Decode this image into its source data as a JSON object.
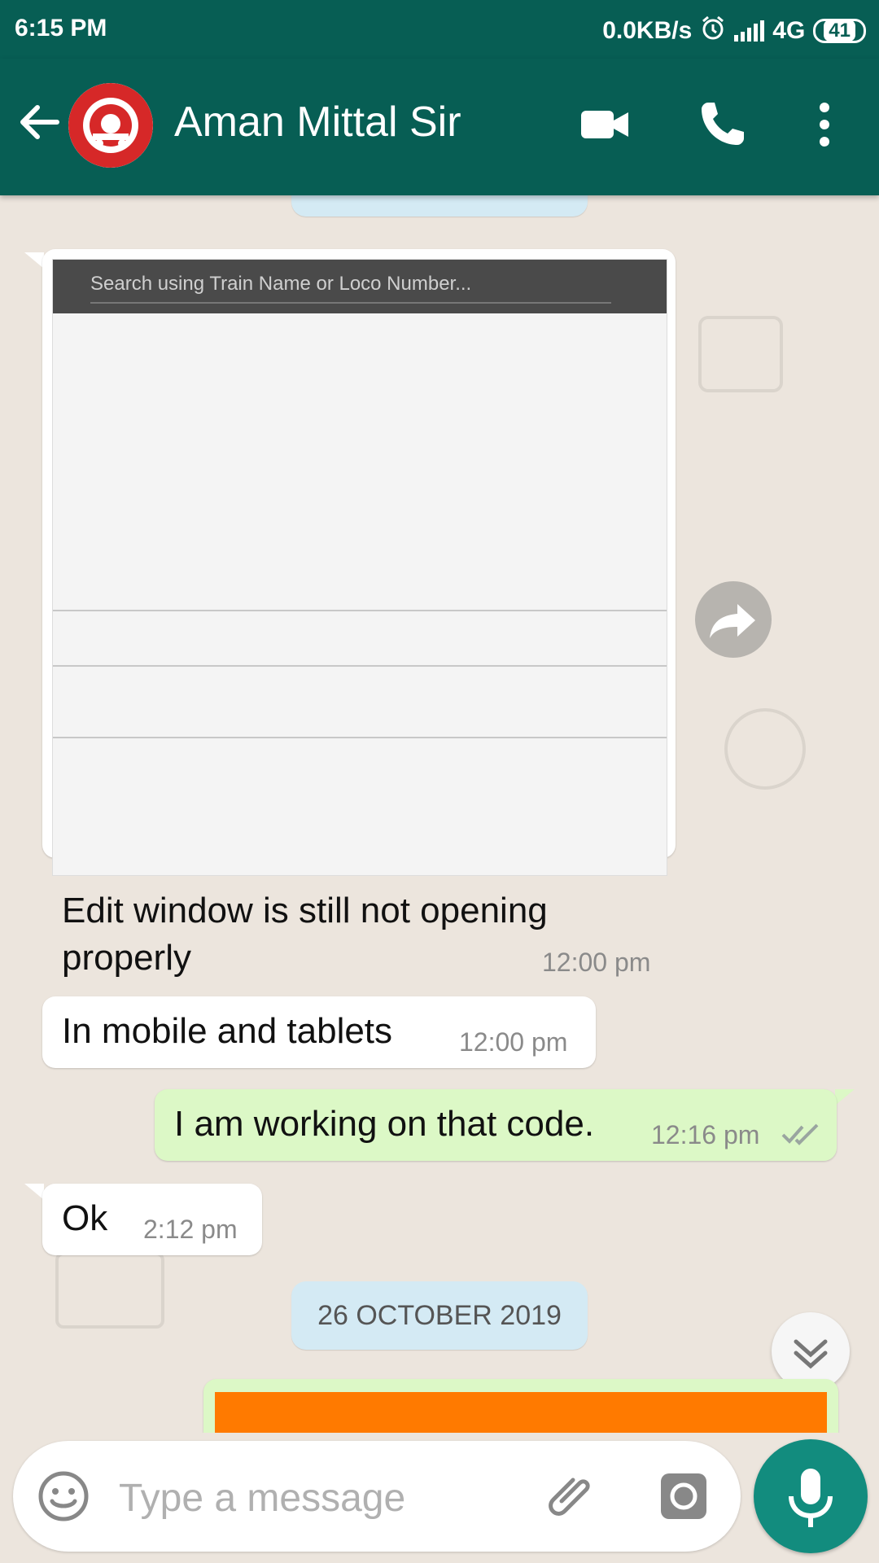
{
  "status_bar": {
    "time": "6:15 PM",
    "speed": "0.0KB/s",
    "network": "4G",
    "battery": "41"
  },
  "header": {
    "contact_name": "Aman Mittal Sir",
    "avatar_icon": "indian-railways-logo",
    "bg_color": "#075e54"
  },
  "chat": {
    "messages": [
      {
        "direction": "incoming",
        "type": "image",
        "image_search_placeholder": "Search using Train Name or Loco Number...",
        "caption": "Edit window is still not opening properly",
        "caption_line1": "Edit window is still not opening",
        "caption_line2": "properly",
        "time": "12:00 pm"
      },
      {
        "direction": "incoming",
        "type": "text",
        "text": "In mobile and tablets",
        "time": "12:00 pm"
      },
      {
        "direction": "outgoing",
        "type": "text",
        "text": "I am working on that code.",
        "time": "12:16 pm",
        "status": "read"
      },
      {
        "direction": "incoming",
        "type": "text",
        "text": "Ok",
        "time": "2:12 pm"
      }
    ],
    "date_separator": "26 OCTOBER 2019"
  },
  "composer": {
    "placeholder": "Type a message",
    "value": ""
  },
  "colors": {
    "accent": "#128c7e",
    "outgoing_bubble": "#dcf8c6",
    "incoming_bubble": "#ffffff",
    "date_chip": "#d4eaf4"
  }
}
